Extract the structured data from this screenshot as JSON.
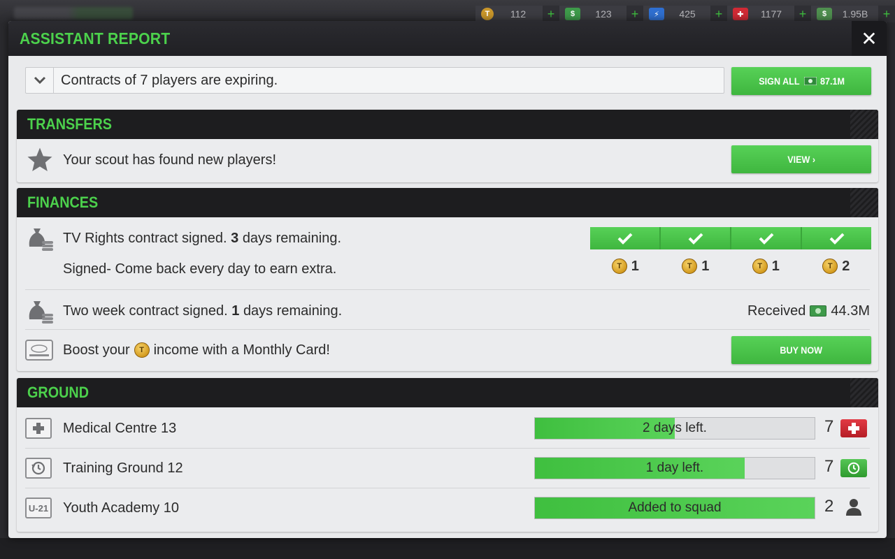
{
  "currencies": [
    {
      "icon": "token-coin-icon",
      "value": "112",
      "color": "#c9962a"
    },
    {
      "icon": "cash-bill-icon",
      "value": "123",
      "color": "#3e9a4a"
    },
    {
      "icon": "energy-bolt-icon",
      "value": "425",
      "color": "#2f6fd0"
    },
    {
      "icon": "medical-cross-icon",
      "value": "1177",
      "color": "#d02a35"
    },
    {
      "icon": "money-bundle-icon",
      "value": "1.95B",
      "color": "#4f8f4f"
    }
  ],
  "modal": {
    "title": "ASSISTANT REPORT",
    "close_label": "✕"
  },
  "contracts": {
    "text": "Contracts of 7 players are expiring.",
    "button_prefix": "SIGN ALL",
    "button_amount": "87.1M"
  },
  "transfers": {
    "title": "TRANSFERS",
    "text": "Your scout has found new players!",
    "button": "VIEW ›"
  },
  "finances": {
    "title": "FINANCES",
    "tv": {
      "text_before": "TV Rights contract signed.",
      "days": "3",
      "text_after": "days remaining.",
      "subtext": "Signed- Come back every day to earn extra.",
      "rewards": [
        "1",
        "1",
        "1",
        "2"
      ]
    },
    "two_week": {
      "text_before": "Two week contract signed.",
      "days": "1",
      "text_after": "days remaining.",
      "received_label": "Received",
      "received_amount": "44.3M"
    },
    "monthly": {
      "text_before": "Boost your",
      "text_after": "income with a Monthly Card!",
      "button": "BUY NOW"
    }
  },
  "ground": {
    "title": "GROUND",
    "items": [
      {
        "name": "Medical Centre 13",
        "progress_text": "2 days left.",
        "progress": 0.5,
        "count": "7",
        "badge": "medical-cross-icon",
        "badge_color": "#d0262f"
      },
      {
        "name": "Training Ground 12",
        "progress_text": "1 day left.",
        "progress": 0.75,
        "count": "7",
        "badge": "training-clock-icon",
        "badge_color": "#3fae3f"
      },
      {
        "name": "Youth Academy 10",
        "progress_text": "Added to squad",
        "progress": 1.0,
        "count": "2",
        "badge": "person-icon",
        "badge_color": "#444444",
        "icon_label": "U-21"
      }
    ]
  }
}
